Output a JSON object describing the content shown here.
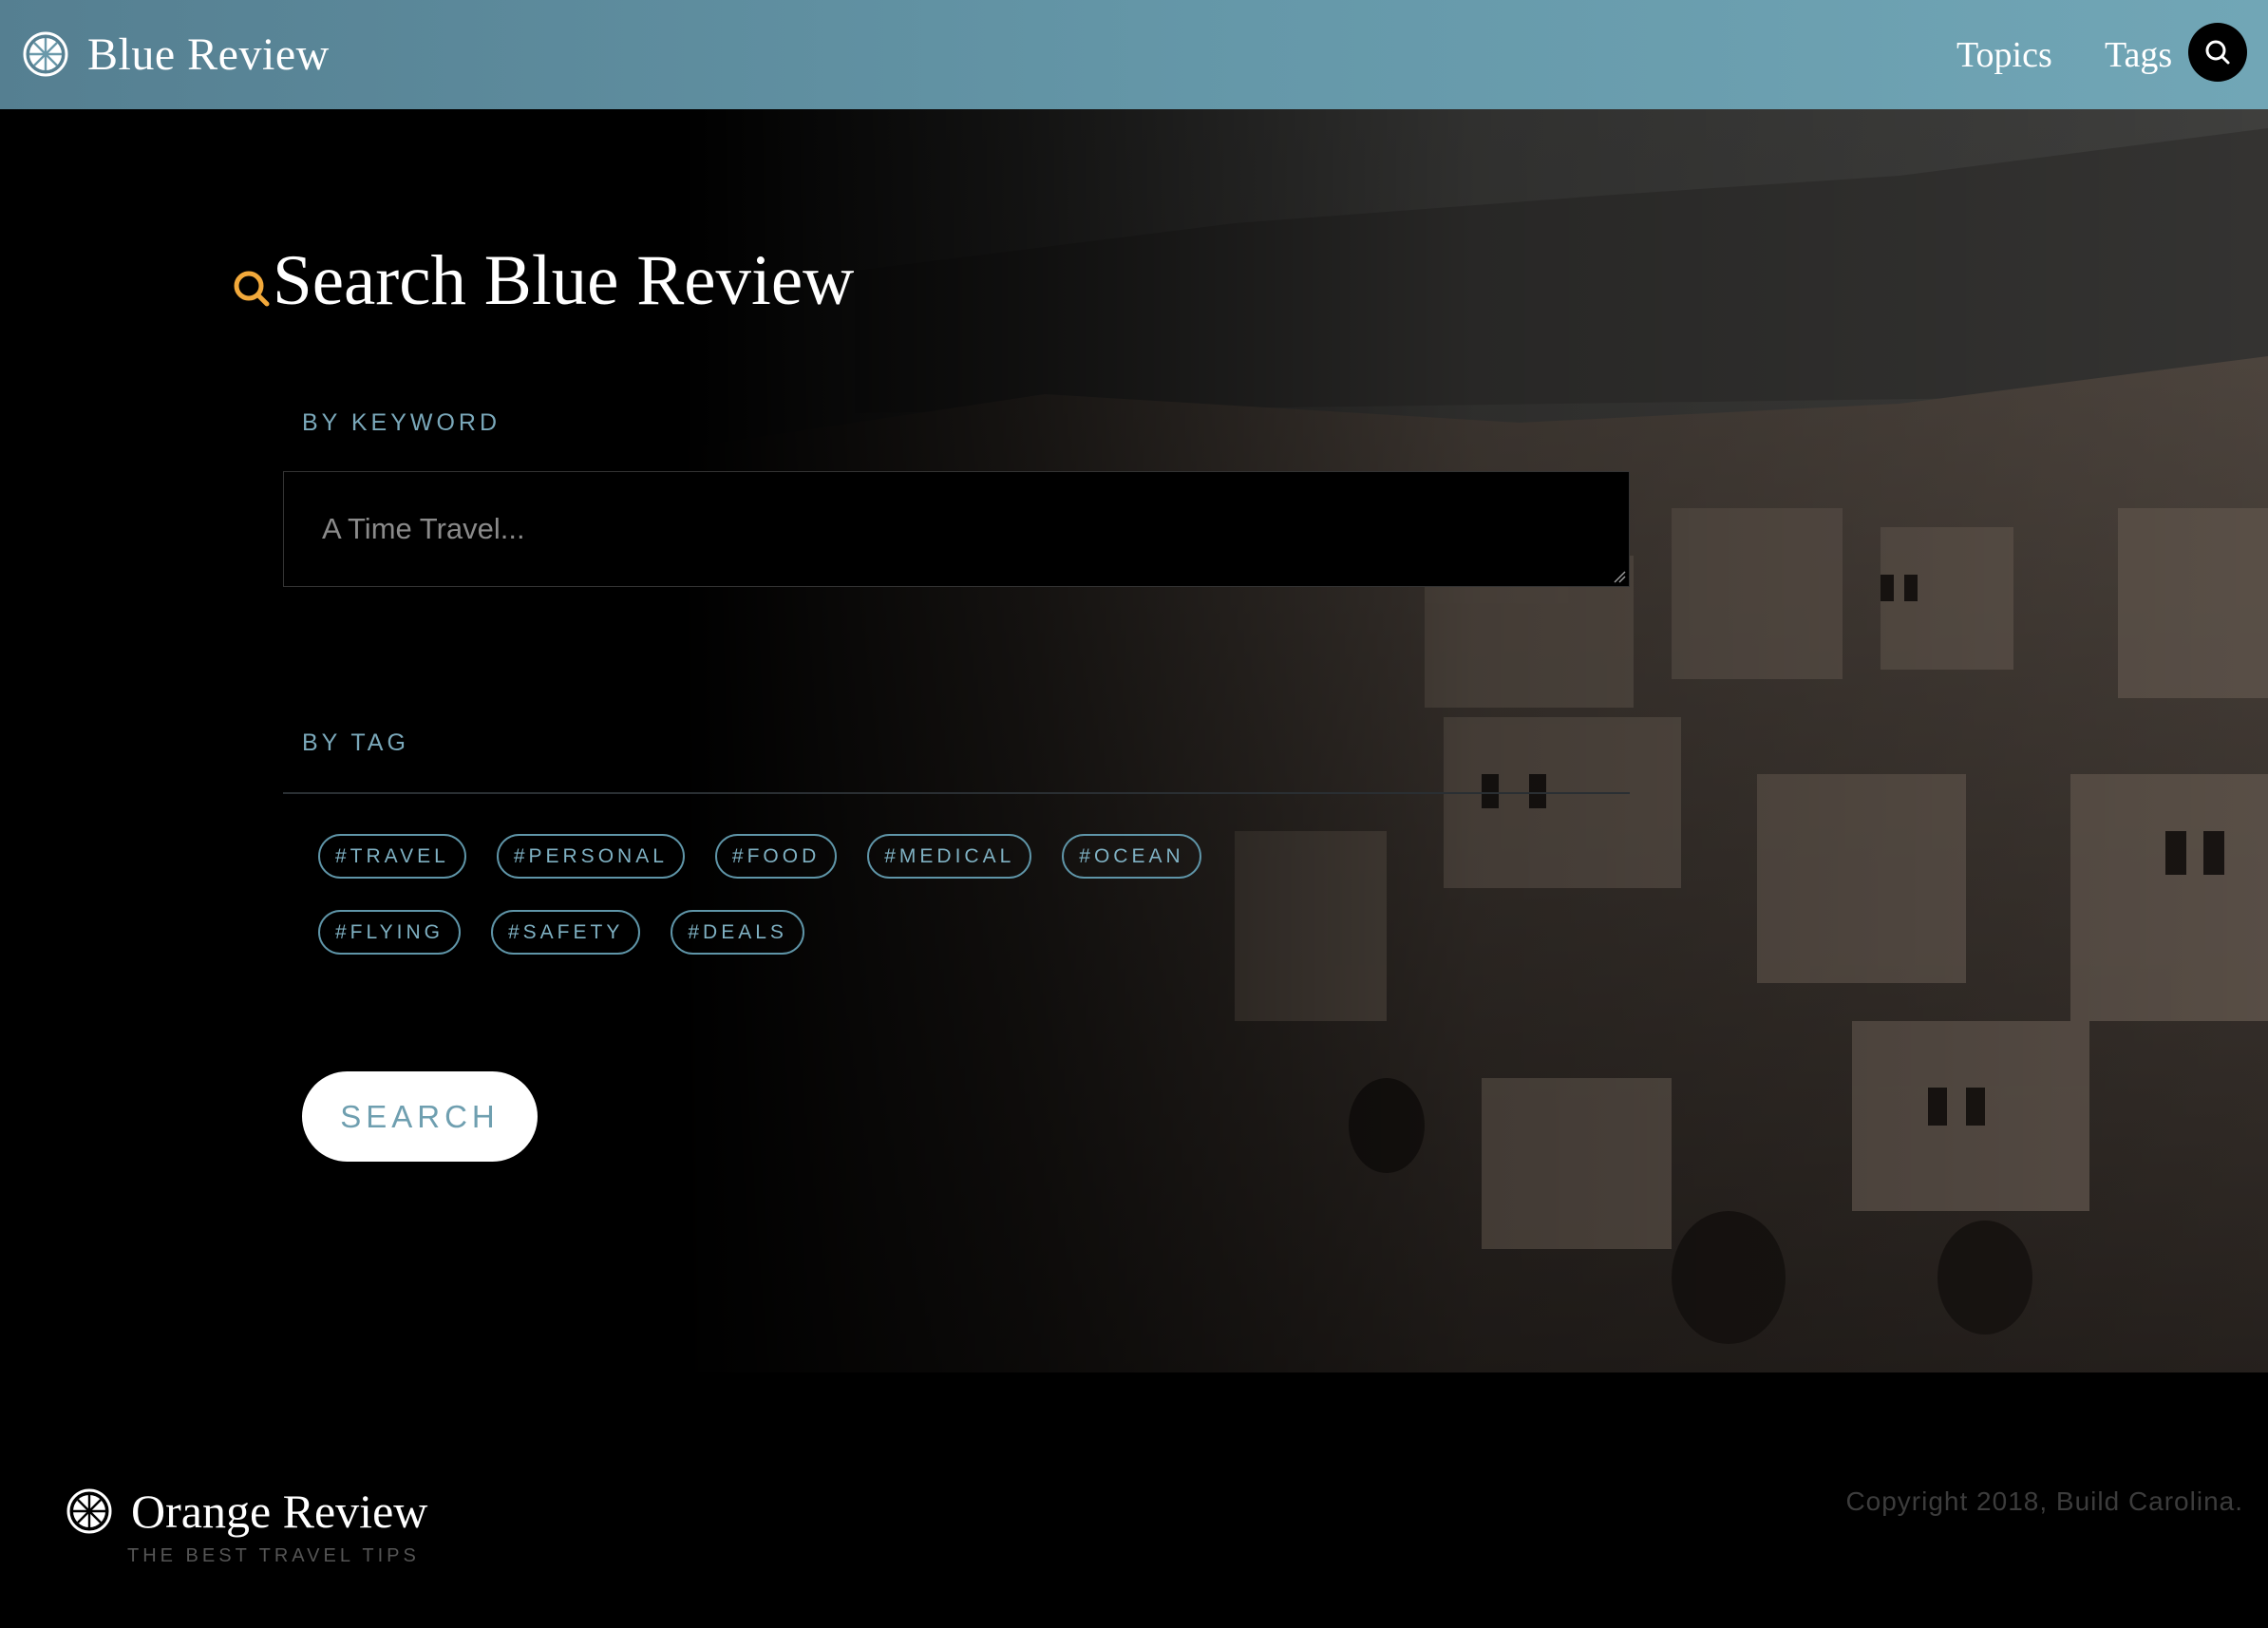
{
  "header": {
    "brand_name": "Blue Review",
    "logo_icon": "citrus-wheel-icon",
    "nav": [
      {
        "label": "Topics"
      },
      {
        "label": "Tags"
      }
    ],
    "search_icon": "search-icon"
  },
  "hero": {
    "title": "Search Blue Review",
    "title_icon": "search-icon",
    "title_icon_color": "#f2a93b",
    "background": "cave-town-landscape-photo",
    "keyword": {
      "label": "BY KEYWORD",
      "placeholder": "A Time Travel..."
    },
    "tag_section": {
      "label": "BY TAG",
      "rows": [
        [
          "#TRAVEL",
          "#PERSONAL",
          "#FOOD",
          "#MEDICAL",
          "#OCEAN"
        ],
        [
          "#FLYING",
          "#SAFETY",
          "#DEALS"
        ]
      ]
    },
    "search_button": "SEARCH"
  },
  "footer": {
    "brand_name": "Orange Review",
    "tagline": "THE BEST TRAVEL TIPS",
    "copyright": "Copyright 2018, Build Carolina."
  },
  "colors": {
    "header_gradient_start": "#557f91",
    "header_gradient_end": "#71a6b6",
    "accent_blue": "#7aa8ba",
    "tag_border": "#5f95a8",
    "search_icon_orange": "#f2a93b"
  }
}
